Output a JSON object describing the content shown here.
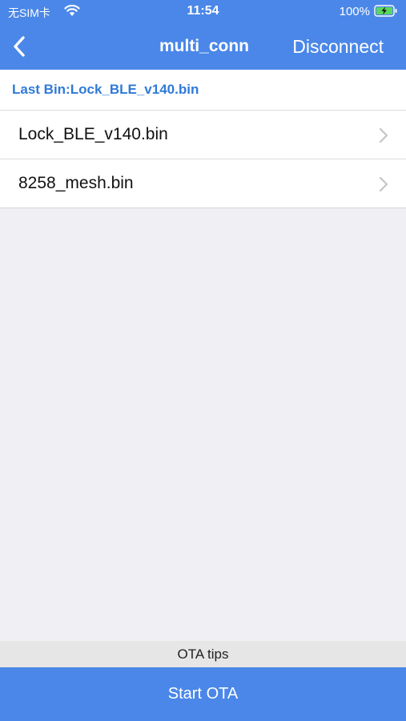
{
  "status_bar": {
    "carrier": "无SIM卡",
    "time": "11:54",
    "battery": "100%",
    "wifi_icon": "wifi-icon",
    "battery_icon": "battery-charging-icon"
  },
  "nav": {
    "back_icon": "chevron-left-icon",
    "title": "multi_conn",
    "action": "Disconnect"
  },
  "last_bin": "Last Bin:Lock_BLE_v140.bin",
  "files": [
    {
      "name": "Lock_BLE_v140.bin"
    },
    {
      "name": "8258_mesh.bin"
    }
  ],
  "ota_tips": "OTA tips",
  "start_button": "Start OTA",
  "colors": {
    "accent": "#4a87e8",
    "last_bin_text": "#2f7ad8",
    "background": "#efeff4"
  }
}
